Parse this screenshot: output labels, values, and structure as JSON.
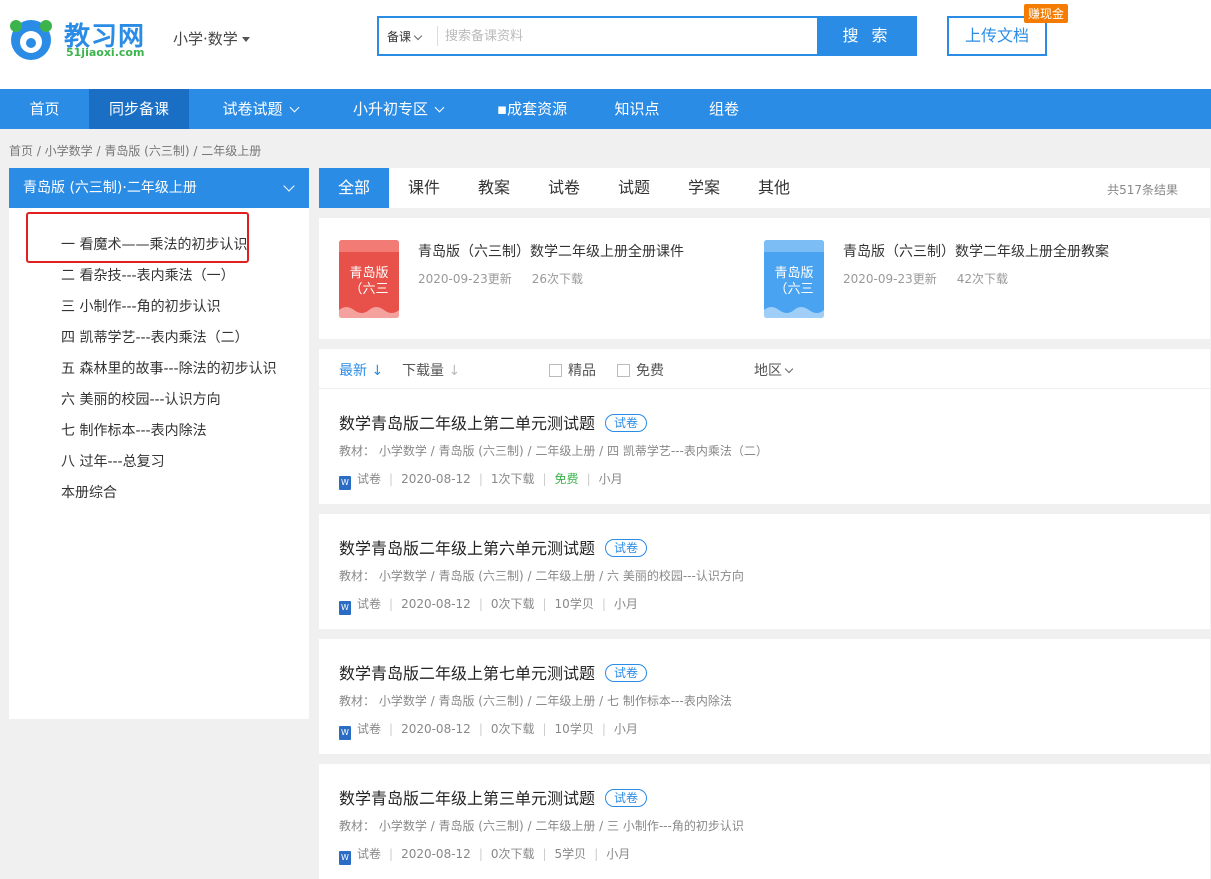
{
  "header": {
    "logo_text": "教习网",
    "logo_sub": "51jiaoxi.com",
    "subject": "小学·数学",
    "search": {
      "type": "备课",
      "placeholder": "搜索备课资料",
      "button": "搜 索"
    },
    "upload": "上传文档",
    "earn_badge": "赚现金"
  },
  "nav": [
    {
      "label": "首页"
    },
    {
      "label": "同步备课",
      "active": true
    },
    {
      "label": "试卷试题"
    },
    {
      "label": "小升初专区"
    },
    {
      "label": "▪成套资源"
    },
    {
      "label": "知识点"
    },
    {
      "label": "组卷"
    }
  ],
  "breadcrumb": "首页 /  小学数学 / 青岛版 (六三制) / 二年级上册",
  "sidebar": {
    "title": "青岛版 (六三制)·二年级上册",
    "items": [
      "一 看魔术——乘法的初步认识",
      "二 看杂技---表内乘法（一）",
      "三 小制作---角的初步认识",
      "四 凯蒂学艺---表内乘法（二）",
      "五 森林里的故事---除法的初步认识",
      "六 美丽的校园---认识方向",
      "七 制作标本---表内除法",
      "八 过年---总复习",
      "本册综合"
    ]
  },
  "tabs": [
    "全部",
    "课件",
    "教案",
    "试卷",
    "试题",
    "学案",
    "其他"
  ],
  "total": "共517条结果",
  "featured": [
    {
      "cover": "青岛版\n（六三",
      "title": "青岛版（六三制）数学二年级上册全册课件",
      "date": "2020-09-23更新",
      "downloads": "26次下载",
      "color": "#e8504a"
    },
    {
      "cover": "青岛版\n（六三",
      "title": "青岛版（六三制）数学二年级上册全册教案",
      "date": "2020-09-23更新",
      "downloads": "42次下载",
      "color": "#4aa3f0"
    }
  ],
  "filter": {
    "newest": "最新",
    "downloads": "下载量",
    "quality": "精品",
    "free": "免费",
    "region": "地区"
  },
  "results": [
    {
      "title": "数学青岛版二年级上第二单元测试题",
      "badge": "试卷",
      "path": "教材： 小学数学  /  青岛版 (六三制)  /  二年级上册  /  四 凯蒂学艺---表内乘法（二）",
      "type": "试卷",
      "date": "2020-08-12",
      "downloads": "1次下载",
      "price": "免费",
      "author": "小月"
    },
    {
      "title": "数学青岛版二年级上第六单元测试题",
      "badge": "试卷",
      "path": "教材： 小学数学  /  青岛版 (六三制)  /  二年级上册  /  六 美丽的校园---认识方向",
      "type": "试卷",
      "date": "2020-08-12",
      "downloads": "0次下载",
      "price": "10学贝",
      "author": "小月"
    },
    {
      "title": "数学青岛版二年级上第七单元测试题",
      "badge": "试卷",
      "path": "教材： 小学数学  /  青岛版 (六三制)  /  二年级上册  /  七 制作标本---表内除法",
      "type": "试卷",
      "date": "2020-08-12",
      "downloads": "0次下载",
      "price": "10学贝",
      "author": "小月"
    },
    {
      "title": "数学青岛版二年级上第三单元测试题",
      "badge": "试卷",
      "path": "教材： 小学数学  /  青岛版 (六三制)  /  二年级上册  /  三 小制作---角的初步认识",
      "type": "试卷",
      "date": "2020-08-12",
      "downloads": "0次下载",
      "price": "5学贝",
      "author": "小月"
    }
  ]
}
